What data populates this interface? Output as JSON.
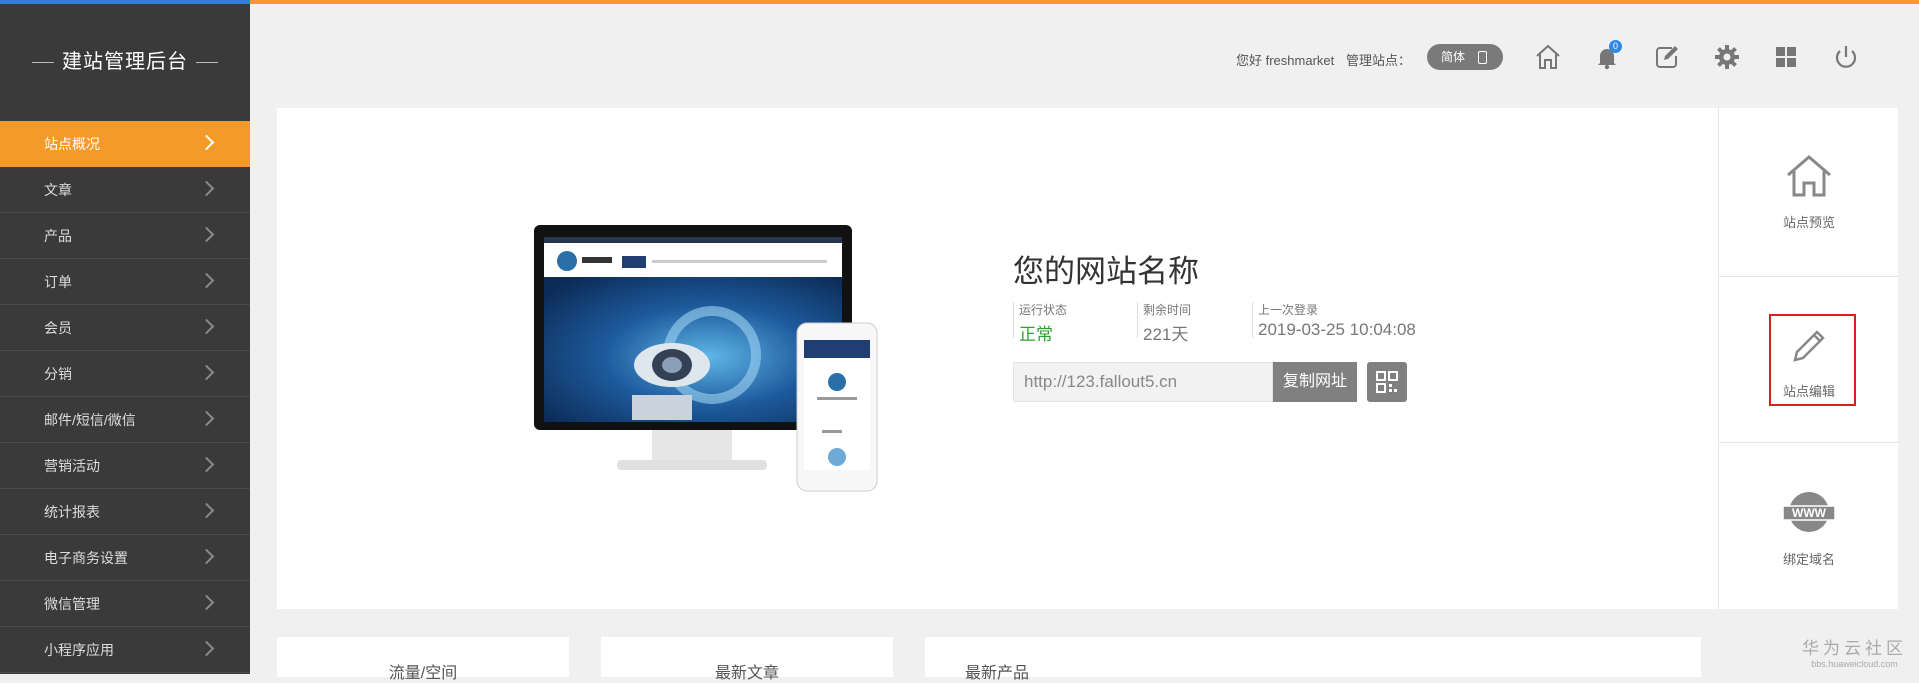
{
  "sidebar": {
    "title": "建站管理后台",
    "items": [
      {
        "label": "站点概况",
        "active": true
      },
      {
        "label": "文章"
      },
      {
        "label": "产品"
      },
      {
        "label": "订单"
      },
      {
        "label": "会员"
      },
      {
        "label": "分销"
      },
      {
        "label": "邮件/短信/微信"
      },
      {
        "label": "营销活动"
      },
      {
        "label": "统计报表"
      },
      {
        "label": "电子商务设置"
      },
      {
        "label": "微信管理"
      },
      {
        "label": "小程序应用"
      }
    ]
  },
  "header": {
    "greeting": "您好 freshmarket",
    "manage_label": "管理站点：",
    "lang_toggle": "简体",
    "notification_count": "0",
    "icons": [
      "home-icon",
      "bell-icon",
      "edit-icon",
      "gear-icon",
      "grid-icon",
      "power-icon"
    ]
  },
  "site": {
    "name": "您的网站名称",
    "status_label": "运行状态",
    "status_value": "正常",
    "remaining_label": "剩余时间",
    "remaining_value": "221天",
    "last_login_label": "上一次登录",
    "last_login_value": "2019-03-25 10:04:08",
    "url": "http://123.fallout5.cn",
    "copy_button": "复制网址"
  },
  "actions": {
    "preview": "站点预览",
    "edit": "站点编辑",
    "bind": "绑定域名"
  },
  "panels": [
    "流量/空间",
    "最新文章",
    "最新产品"
  ],
  "watermark": {
    "brand": "华为云社区",
    "url": "bbs.huaweicloud.com"
  },
  "colors": {
    "accent": "#f39a2b",
    "sidebar": "#3a3a3a",
    "highlight": "#d82020"
  }
}
